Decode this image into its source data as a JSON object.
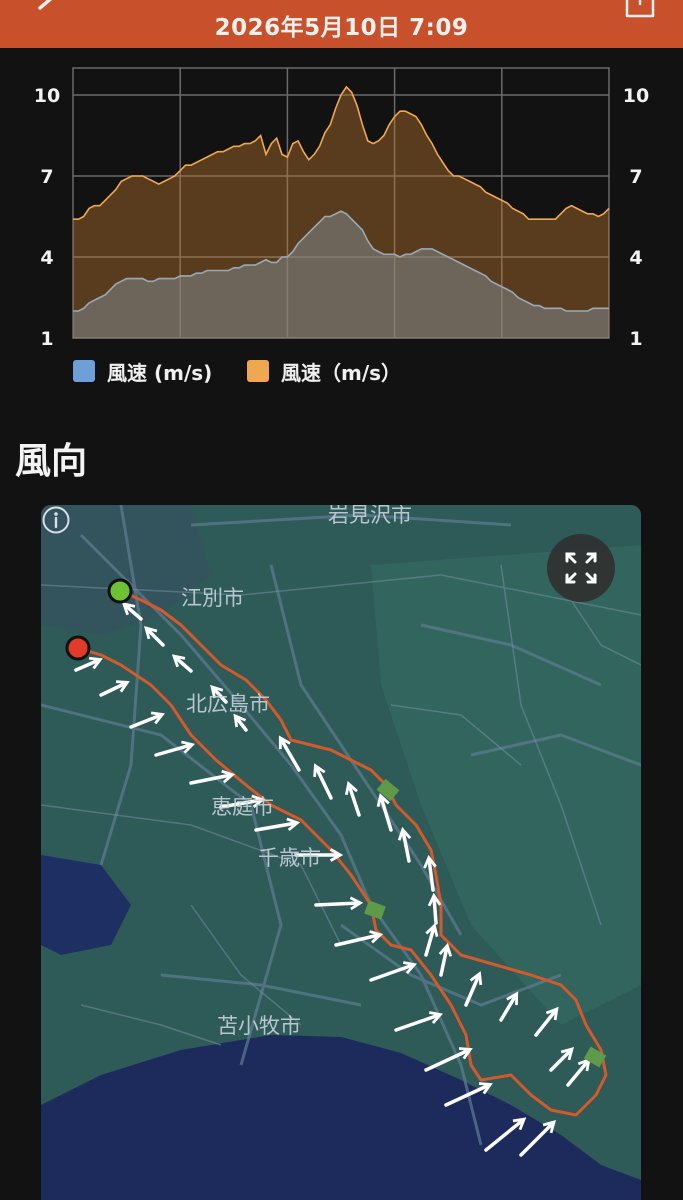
{
  "header": {
    "title": "2026年5月10日 7:09",
    "back_icon": "chevron-left-icon",
    "share_icon": "share-icon",
    "background_color": "#c8502a"
  },
  "chart_data": {
    "type": "area",
    "title": "",
    "xlabel": "",
    "ylabel": "",
    "ylim": [
      1,
      11
    ],
    "y_ticks": [
      "1",
      "4",
      "7",
      "10"
    ],
    "y_tick_values": [
      1,
      4,
      7,
      10
    ],
    "grid": true,
    "legend_position": "bottom-left",
    "x_index": [
      0,
      1,
      2,
      3,
      4,
      5,
      6,
      7,
      8,
      9,
      10,
      11,
      12,
      13,
      14,
      15,
      16,
      17,
      18,
      19,
      20,
      21,
      22,
      23,
      24,
      25,
      26,
      27,
      28,
      29,
      30,
      31,
      32,
      33,
      34,
      35,
      36,
      37,
      38,
      39,
      40,
      41,
      42,
      43,
      44,
      45,
      46,
      47,
      48,
      49,
      50,
      51,
      52,
      53,
      54,
      55,
      56,
      57,
      58,
      59,
      60,
      61,
      62,
      63,
      64,
      65,
      66,
      67,
      68,
      69,
      70,
      71,
      72,
      73,
      74,
      75,
      76,
      77,
      78,
      79,
      80,
      81,
      82,
      83,
      84,
      85,
      86,
      87,
      88,
      89,
      90,
      91,
      92,
      93,
      94,
      95,
      96,
      97,
      98,
      99,
      100
    ],
    "series": [
      {
        "name": "風速 (m/s)",
        "color": "#f0a850",
        "values": [
          5.4,
          5.4,
          5.5,
          5.8,
          5.9,
          5.9,
          6.1,
          6.3,
          6.5,
          6.8,
          6.9,
          7.0,
          7.0,
          7.0,
          6.9,
          6.8,
          6.7,
          6.8,
          6.9,
          7.0,
          7.2,
          7.4,
          7.4,
          7.5,
          7.6,
          7.7,
          7.8,
          7.9,
          7.9,
          8.0,
          8.1,
          8.1,
          8.2,
          8.2,
          8.3,
          8.5,
          7.8,
          8.2,
          8.4,
          7.8,
          7.7,
          8.2,
          8.3,
          7.9,
          7.6,
          7.8,
          8.1,
          8.6,
          8.9,
          9.5,
          10.0,
          10.3,
          10.1,
          9.6,
          8.9,
          8.3,
          8.2,
          8.3,
          8.5,
          8.9,
          9.2,
          9.4,
          9.4,
          9.3,
          9.2,
          8.9,
          8.5,
          8.2,
          7.8,
          7.5,
          7.2,
          7.0,
          7.0,
          6.9,
          6.8,
          6.7,
          6.6,
          6.4,
          6.3,
          6.2,
          6.1,
          6.0,
          5.8,
          5.7,
          5.6,
          5.4,
          5.4,
          5.4,
          5.4,
          5.4,
          5.4,
          5.6,
          5.8,
          5.9,
          5.8,
          5.7,
          5.6,
          5.6,
          5.5,
          5.6,
          5.8
        ]
      },
      {
        "name": "風速（m/s）",
        "color": "#9aa9b5",
        "values": [
          2.0,
          2.0,
          2.1,
          2.3,
          2.4,
          2.5,
          2.6,
          2.8,
          3.0,
          3.1,
          3.2,
          3.2,
          3.2,
          3.2,
          3.1,
          3.1,
          3.2,
          3.2,
          3.2,
          3.2,
          3.3,
          3.3,
          3.3,
          3.4,
          3.4,
          3.5,
          3.5,
          3.5,
          3.5,
          3.5,
          3.6,
          3.6,
          3.7,
          3.7,
          3.7,
          3.8,
          3.9,
          3.8,
          3.8,
          4.0,
          4.0,
          4.2,
          4.5,
          4.7,
          4.9,
          5.1,
          5.3,
          5.5,
          5.5,
          5.6,
          5.7,
          5.6,
          5.4,
          5.2,
          5.0,
          4.6,
          4.3,
          4.2,
          4.1,
          4.1,
          4.1,
          4.0,
          4.1,
          4.1,
          4.2,
          4.3,
          4.3,
          4.3,
          4.2,
          4.1,
          4.0,
          3.9,
          3.8,
          3.7,
          3.6,
          3.5,
          3.4,
          3.3,
          3.1,
          3.0,
          2.9,
          2.8,
          2.7,
          2.5,
          2.4,
          2.3,
          2.2,
          2.2,
          2.1,
          2.1,
          2.1,
          2.1,
          2.0,
          2.0,
          2.0,
          2.0,
          2.0,
          2.1,
          2.1,
          2.1,
          2.1
        ]
      }
    ]
  },
  "legend": {
    "items": [
      {
        "label": "風速 (m/s)",
        "color": "#6e9fd6"
      },
      {
        "label": "風速（m/s）",
        "color": "#f0a850"
      }
    ]
  },
  "wind_section": {
    "title": "風向"
  },
  "map": {
    "cities": [
      "岩見沢市",
      "江別市",
      "北広島市",
      "恵庭市",
      "千歳市",
      "苫小牧市"
    ],
    "fullscreen_icon": "fullscreen-icon",
    "info_icon": "info-icon",
    "route_color": "#d45a2c",
    "start_marker_color": "#6cc230",
    "end_marker_color": "#e23a28",
    "checkpoint_icon": "chevron-checkpoint-icon",
    "wind_arrow_icon": "wind-arrow-icon"
  }
}
